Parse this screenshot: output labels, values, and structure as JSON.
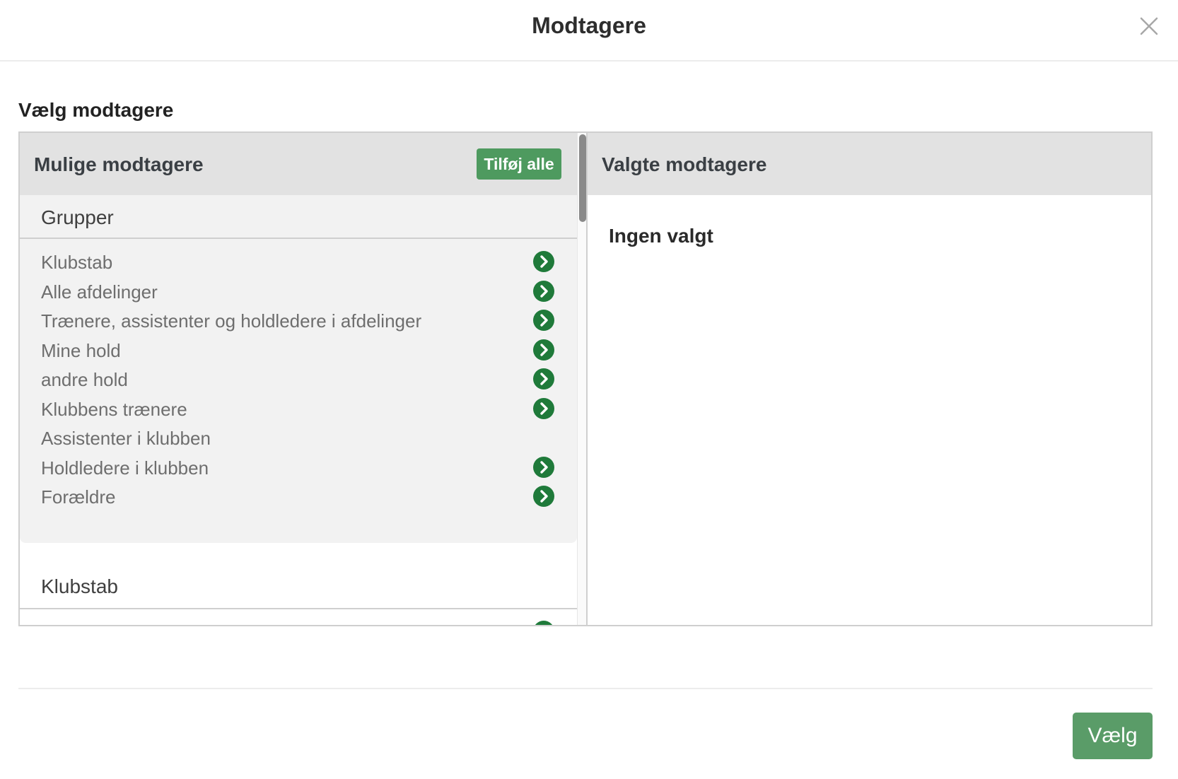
{
  "modal": {
    "title": "Modtagere"
  },
  "section": {
    "title": "Vælg modtagere"
  },
  "left_panel": {
    "title": "Mulige modtagere",
    "add_all_label": "Tilføj alle",
    "groups_heading": "Grupper",
    "groups": [
      {
        "label": "Klubstab",
        "has_arrow": true
      },
      {
        "label": "Alle afdelinger",
        "has_arrow": true
      },
      {
        "label": "Trænere, assistenter og holdledere i afdelinger",
        "has_arrow": true
      },
      {
        "label": "Mine hold",
        "has_arrow": true
      },
      {
        "label": "andre hold",
        "has_arrow": true
      },
      {
        "label": "Klubbens trænere",
        "has_arrow": true
      },
      {
        "label": "Assistenter i klubben",
        "has_arrow": false
      },
      {
        "label": "Holdledere i klubben",
        "has_arrow": true
      },
      {
        "label": "Forældre",
        "has_arrow": true
      }
    ],
    "klubstab_heading": "Klubstab"
  },
  "right_panel": {
    "title": "Valgte modtagere",
    "empty_text": "Ingen valgt"
  },
  "footer": {
    "submit_label": "Vælg"
  },
  "icons": {
    "close": "close-icon",
    "arrow": "chevron-right-circle-icon"
  },
  "colors": {
    "accent_green": "#4e9a5f",
    "arrow_green": "#1f7a3a",
    "submit_green": "#5a9c68",
    "panel_header_bg": "#e2e2e2",
    "group_bg": "#f2f2f2"
  }
}
